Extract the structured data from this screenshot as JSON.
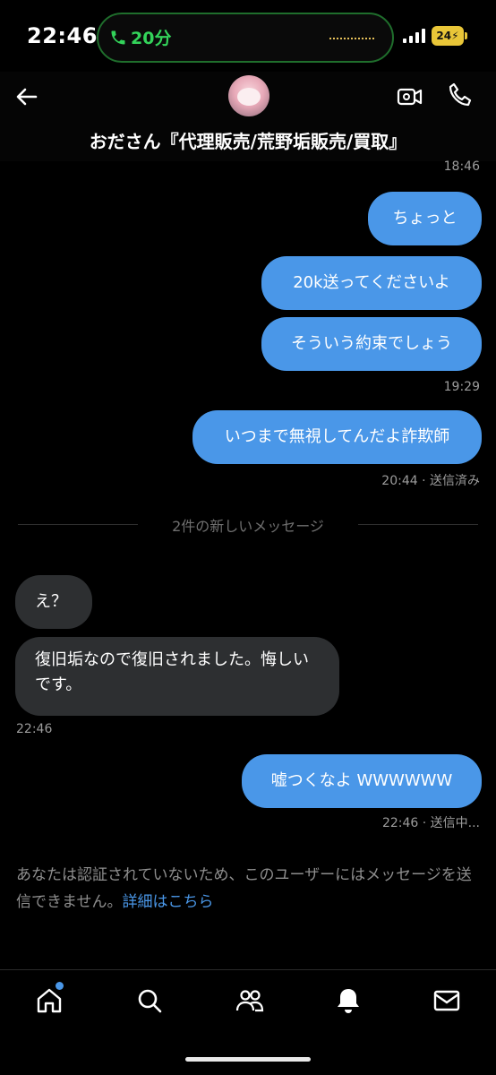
{
  "status_bar": {
    "time": "22:46",
    "call_duration": "20分",
    "battery": "24"
  },
  "header": {
    "contact_name": "おださん『代理販売/荒野垢販売/買取』"
  },
  "messages": {
    "ts1": "18:46",
    "out1": "ちょっと",
    "out2": "20k送ってくださいよ",
    "out3": "そういう約束でしょう",
    "ts2": "19:29",
    "out4": "いつまで無視してんだよ詐欺師",
    "ts3": "20:44 · 送信済み",
    "divider": "2件の新しいメッセージ",
    "in1": "え？",
    "in2": "復旧垢なので復旧されました。悔しいです。",
    "ts4": "22:46",
    "out5": "嘘つくなよ WWWWWW",
    "ts5": "22:46 · 送信中..."
  },
  "notice": {
    "text": "あなたは認証されていないため、このユーザーにはメッセージを送信できません。",
    "link": "詳細はこちら"
  },
  "colors": {
    "accent": "#4a97e8",
    "incoming_bubble": "#2d2f31",
    "call_green": "#33d35a",
    "battery": "#e9c638"
  },
  "icons": [
    "phone-icon",
    "back-arrow-icon",
    "video-call-icon",
    "home-icon",
    "search-icon",
    "communities-icon",
    "bell-icon",
    "mail-icon"
  ]
}
